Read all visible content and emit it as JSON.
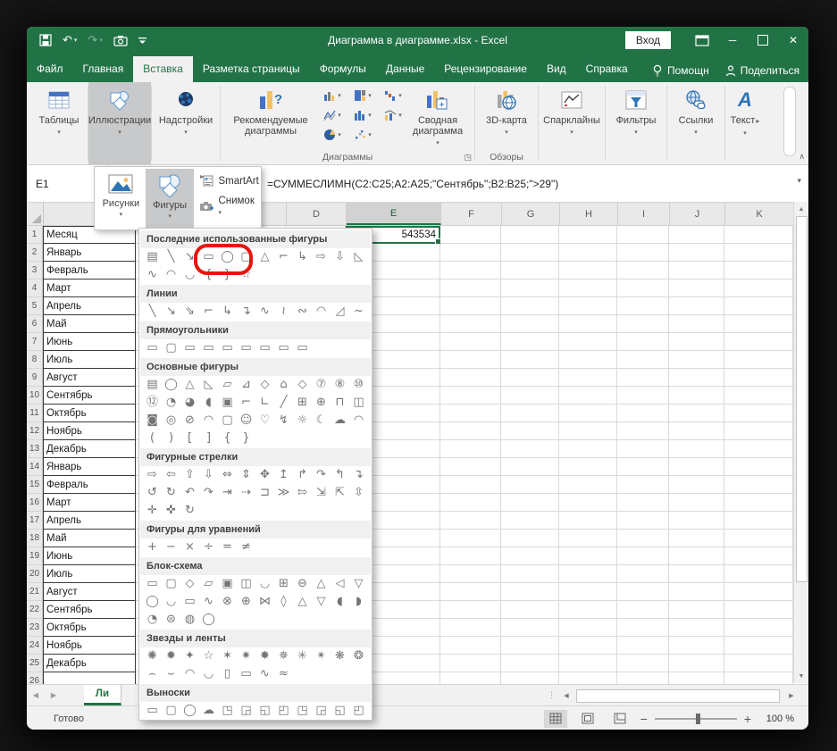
{
  "colors": {
    "accent": "#217346",
    "annotation": "#e4170e"
  },
  "window": {
    "title": "Диаграмма в диаграмме.xlsx - Excel",
    "signin_label": "Вход"
  },
  "tabs": [
    {
      "label": "Файл"
    },
    {
      "label": "Главная"
    },
    {
      "label": "Вставка"
    },
    {
      "label": "Разметка страницы"
    },
    {
      "label": "Формулы"
    },
    {
      "label": "Данные"
    },
    {
      "label": "Рецензирование"
    },
    {
      "label": "Вид"
    },
    {
      "label": "Справка"
    },
    {
      "label": "Помощн"
    },
    {
      "label": "Поделиться"
    }
  ],
  "ribbon": {
    "tables_label": "Таблицы",
    "illustrations_label": "Иллюстрации",
    "addins_label": "Надстройки",
    "recommended_label": "Рекомендуемые диаграммы",
    "charts_group_label": "Диаграммы",
    "pivot_label": "Сводная диаграмма",
    "map3d_label": "3D-карта",
    "tours_group_label": "Обзоры",
    "sparklines_label": "Спарклайны",
    "filters_label": "Фильтры",
    "links_label": "Ссылки",
    "text_label": "Текст"
  },
  "illustrations_menu": {
    "pictures_label": "Рисунки",
    "shapes_label": "Фигуры",
    "smartart_label": "SmartArt",
    "screenshot_label": "Снимок"
  },
  "formula_bar": {
    "name_box": "E1",
    "formula": "=СУММЕСЛИМН(C2:C25;A2:A25;\"Сентябрь\";B2:B25;\">29\")"
  },
  "shapes_menu": {
    "sections": [
      {
        "title": "Последние использованные фигуры",
        "rows": [
          [
            "▤",
            "╲",
            "↘",
            "▭",
            "◯",
            "▢",
            "△",
            "⌐",
            "↳",
            "⇨",
            "⇩",
            "◺"
          ],
          [
            "∿",
            "◠",
            "◡",
            "{",
            "}",
            "☆"
          ]
        ]
      },
      {
        "title": "Линии",
        "rows": [
          [
            "╲",
            "↘",
            "⇘",
            "⌐",
            "↳",
            "↴",
            "∿",
            "≀",
            "∾",
            "◠",
            "◿",
            "~"
          ]
        ]
      },
      {
        "title": "Прямоугольники",
        "rows": [
          [
            "▭",
            "▢",
            "▭",
            "▭",
            "▭",
            "▭",
            "▭",
            "▭",
            "▭"
          ]
        ]
      },
      {
        "title": "Основные фигуры",
        "rows": [
          [
            "▤",
            "◯",
            "△",
            "◺",
            "▱",
            "⊿",
            "◇",
            "⌂",
            "◇",
            "⑦",
            "⑧",
            "⑩"
          ],
          [
            "⑫",
            "◔",
            "◕",
            "◖",
            "▣",
            "⌐",
            "∟",
            "╱",
            "⊞",
            "⊕",
            "⊓",
            "◫"
          ],
          [
            "◙",
            "◎",
            "⊘",
            "◠",
            "▢",
            "☺",
            "♡",
            "↯",
            "☼",
            "☾",
            "☁",
            "◠"
          ],
          [
            "(",
            ")",
            "[",
            "]",
            "{",
            "}"
          ]
        ]
      },
      {
        "title": "Фигурные стрелки",
        "rows": [
          [
            "⇨",
            "⇦",
            "⇧",
            "⇩",
            "⇔",
            "⇕",
            "✥",
            "↥",
            "↱",
            "↷",
            "↰",
            "↴"
          ],
          [
            "↺",
            "↻",
            "↶",
            "↷",
            "⇥",
            "⇢",
            "⊐",
            "≫",
            "⇰",
            "⇲",
            "⇱",
            "⇳"
          ],
          [
            "✛",
            "✜",
            "↻"
          ]
        ]
      },
      {
        "title": "Фигуры для уравнений",
        "rows": [
          [
            "+",
            "−",
            "×",
            "÷",
            "=",
            "≠"
          ]
        ]
      },
      {
        "title": "Блок-схема",
        "rows": [
          [
            "▭",
            "▢",
            "◇",
            "▱",
            "▣",
            "◫",
            "◡",
            "⊞",
            "⊖",
            "△",
            "◁",
            "▽"
          ],
          [
            "◯",
            "◡",
            "▭",
            "∿",
            "⊗",
            "⊕",
            "⋈",
            "◊",
            "△",
            "▽",
            "◖",
            "◗"
          ],
          [
            "◔",
            "⊜",
            "◍",
            "◯"
          ]
        ]
      },
      {
        "title": "Звезды и ленты",
        "rows": [
          [
            "✺",
            "✹",
            "✦",
            "☆",
            "✶",
            "✷",
            "✸",
            "✵",
            "✳",
            "✴",
            "❋",
            "❂"
          ],
          [
            "⌢",
            "⌣",
            "◠",
            "◡",
            "▯",
            "▭",
            "∿",
            "≈"
          ]
        ]
      },
      {
        "title": "Выноски",
        "rows": [
          [
            "▭",
            "▢",
            "◯",
            "☁",
            "◳",
            "◲",
            "◱",
            "◰",
            "◳",
            "◲",
            "◱",
            "◰"
          ]
        ]
      }
    ]
  },
  "grid": {
    "columns": [
      "D",
      "E",
      "F",
      "G",
      "H",
      "I",
      "J",
      "K"
    ],
    "selected_column": "E",
    "active_cell": "E1",
    "active_cell_value": "543534",
    "rows": [
      {
        "n": "1",
        "a": "Месяц"
      },
      {
        "n": "2",
        "a": "Январь"
      },
      {
        "n": "3",
        "a": "Февраль"
      },
      {
        "n": "4",
        "a": "Март"
      },
      {
        "n": "5",
        "a": "Апрель"
      },
      {
        "n": "6",
        "a": "Май"
      },
      {
        "n": "7",
        "a": "Июнь"
      },
      {
        "n": "8",
        "a": "Июль"
      },
      {
        "n": "9",
        "a": "Август"
      },
      {
        "n": "10",
        "a": "Сентябрь"
      },
      {
        "n": "11",
        "a": "Октябрь"
      },
      {
        "n": "12",
        "a": "Ноябрь"
      },
      {
        "n": "13",
        "a": "Декабрь"
      },
      {
        "n": "14",
        "a": "Январь"
      },
      {
        "n": "15",
        "a": "Февраль"
      },
      {
        "n": "16",
        "a": "Март"
      },
      {
        "n": "17",
        "a": "Апрель"
      },
      {
        "n": "18",
        "a": "Май"
      },
      {
        "n": "19",
        "a": "Июнь"
      },
      {
        "n": "20",
        "a": "Июль"
      },
      {
        "n": "21",
        "a": "Август"
      },
      {
        "n": "22",
        "a": "Сентябрь"
      },
      {
        "n": "23",
        "a": "Октябрь"
      },
      {
        "n": "24",
        "a": "Ноябрь"
      },
      {
        "n": "25",
        "a": "Декабрь"
      },
      {
        "n": "26",
        "a": ""
      }
    ]
  },
  "sheet_bar": {
    "tab_label": "Ли"
  },
  "status_bar": {
    "ready_label": "Готово",
    "zoom_label": "100 %"
  }
}
